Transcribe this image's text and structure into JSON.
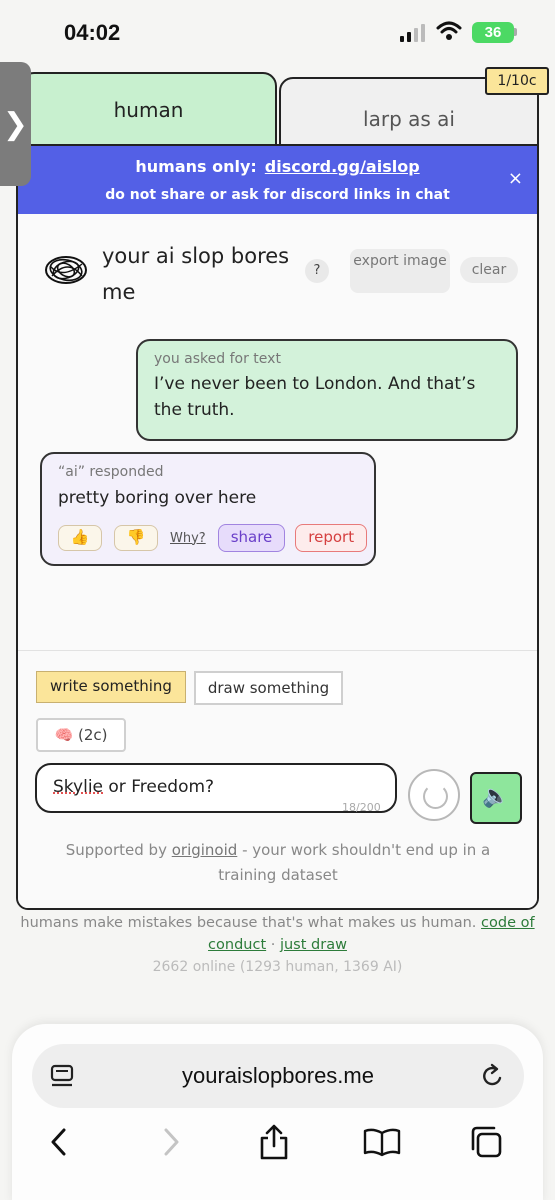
{
  "status_bar": {
    "time": "04:02",
    "battery": "36"
  },
  "tabs": {
    "human": "human",
    "larp": "larp as ai"
  },
  "credit_badge": "1/10c",
  "banner": {
    "line1_prefix": "humans only:",
    "line1_link": "discord.gg/aislop",
    "line2": "do not share or ask for discord links in chat",
    "close": "×"
  },
  "header": {
    "title": "your ai slop bores me",
    "help": "?",
    "export": "export image",
    "clear": "clear"
  },
  "messages": {
    "user_label": "you asked for text",
    "user_text": "I’ve never been to London. And that’s the truth.",
    "ai_label": "“ai” responded",
    "ai_text": "pretty boring over here",
    "thumbs_up": "👍",
    "thumbs_down": "👎",
    "why": "Why?",
    "share": "share",
    "report": "report"
  },
  "composer": {
    "write_mode": "write something",
    "draw_mode": "draw something",
    "brain_button": "🧠 (2c)",
    "input_word1": "Skylie",
    "input_rest": " or Freedom?",
    "counter": "18/200",
    "send_icon": "🔈"
  },
  "supported": {
    "prefix": "Supported by ",
    "link": "originoid",
    "suffix": " - your work shouldn't end up in a training dataset"
  },
  "footer": {
    "text": "humans make mistakes because that's what makes us human.",
    "code_link": "code of conduct",
    "sep": " · ",
    "draw_link": "just draw",
    "online": "2662 online (1293 human, 1369 AI)"
  },
  "browser": {
    "url": "youraislopbores.me"
  }
}
